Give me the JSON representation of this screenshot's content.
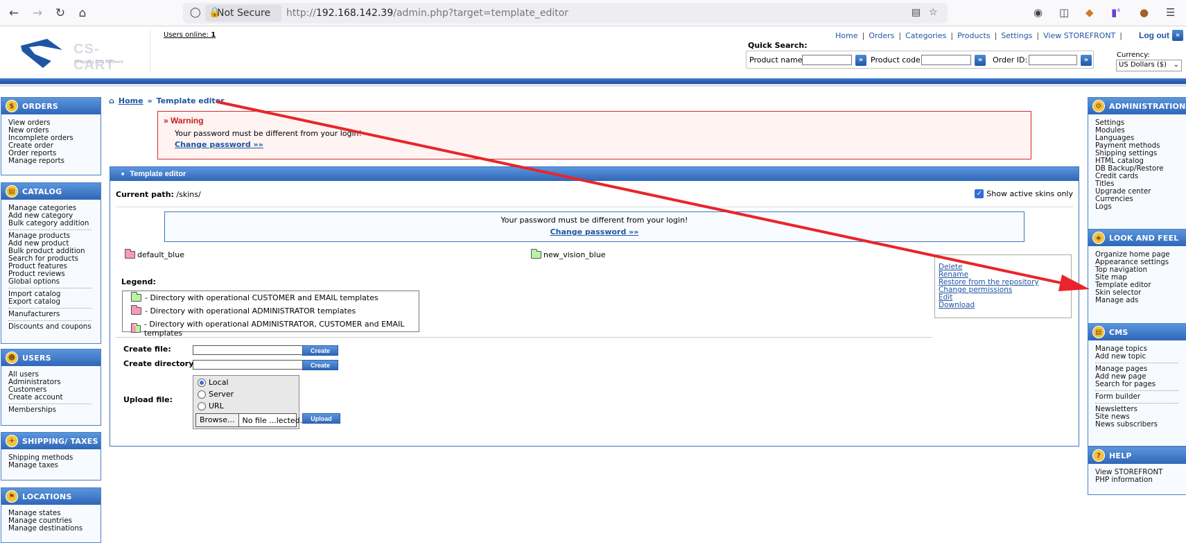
{
  "browser": {
    "security_label": "Not Secure",
    "url_prefix": "http://",
    "url_host": "192.168.142.39",
    "url_path": "/admin.php?target=template_editor",
    "extension_badge": "4"
  },
  "header": {
    "logo_text": "CS-CART",
    "logo_subtitle": "Shopping Cart Software",
    "users_online_label": "Users online:",
    "users_online_count": "1",
    "nav": [
      "Home",
      "Orders",
      "Categories",
      "Products",
      "Settings",
      "View STOREFRONT"
    ],
    "logout": "Log out",
    "quick_search": {
      "title": "Quick Search:",
      "product_name_label": "Product name:",
      "product_code_label": "Product code:",
      "order_id_label": "Order ID:"
    },
    "currency_label": "Currency:",
    "currency_value": "US Dollars ($)"
  },
  "left_menu": {
    "orders": {
      "title": "ORDERS",
      "items": [
        "View orders",
        "New orders",
        "Incomplete orders",
        "Create order",
        "Order reports",
        "Manage reports"
      ]
    },
    "catalog": {
      "title": "CATALOG",
      "groups": [
        [
          "Manage categories",
          "Add new category",
          "Bulk category addition"
        ],
        [
          "Manage products",
          "Add new product",
          "Bulk product addition",
          "Search for products",
          "Product features",
          "Product reviews",
          "Global options"
        ],
        [
          "Import catalog",
          "Export catalog"
        ],
        [
          "Manufacturers"
        ],
        [
          "Discounts and coupons"
        ]
      ]
    },
    "users": {
      "title": "USERS",
      "groups": [
        [
          "All users",
          "Administrators",
          "Customers",
          "Create account"
        ],
        [
          "Memberships"
        ]
      ]
    },
    "shipping": {
      "title": "SHIPPING/ TAXES",
      "items": [
        "Shipping methods",
        "Manage taxes"
      ]
    },
    "locations": {
      "title": "LOCATIONS",
      "items": [
        "Manage states",
        "Manage countries",
        "Manage destinations"
      ]
    }
  },
  "right_menu": {
    "administration": {
      "title": "ADMINISTRATION",
      "items": [
        "Settings",
        "Modules",
        "Languages",
        "Payment methods",
        "Shipping settings",
        "HTML catalog",
        "DB Backup/Restore",
        "Credit cards",
        "Titles",
        "Upgrade center",
        "Currencies",
        "Logs"
      ]
    },
    "look_feel": {
      "title": "LOOK AND FEEL",
      "items": [
        "Organize home page",
        "Appearance settings",
        "Top navigation",
        "Site map",
        "Template editor",
        "Skin selector",
        "Manage ads"
      ]
    },
    "cms": {
      "title": "CMS",
      "groups": [
        [
          "Manage topics",
          "Add new topic"
        ],
        [
          "Manage pages",
          "Add new page",
          "Search for pages"
        ],
        [
          "Form builder"
        ],
        [
          "Newsletters",
          "Site news",
          "News subscribers"
        ]
      ]
    },
    "help": {
      "title": "HELP",
      "items": [
        "View STOREFRONT",
        "PHP information"
      ]
    }
  },
  "breadcrumb": {
    "home": "Home",
    "current": "Template editor"
  },
  "warning": {
    "title": "Warning",
    "text": "Your password must be different from your login!",
    "link": "Change password »»"
  },
  "template_editor": {
    "title": "Template editor",
    "current_path_label": "Current path:",
    "current_path": "/skins/",
    "show_active_label": "Show active skins only",
    "notice_text": "Your password must be different from your login!",
    "notice_link": "Change password »»",
    "folders": [
      "default_blue",
      "new_vision_blue"
    ],
    "legend_title": "Legend:",
    "legend": [
      "- Directory with operational CUSTOMER and EMAIL templates",
      "- Directory with operational ADMINISTRATOR templates",
      "- Directory with operational ADMINISTRATOR, CUSTOMER and EMAIL templates"
    ],
    "actions": [
      "Delete",
      "Rename",
      "Restore from the repository",
      "Change permissions",
      "Edit",
      "Download"
    ],
    "create_file_label": "Create file:",
    "create_dir_label": "Create directory:",
    "create_btn": "Create",
    "upload_label": "Upload file:",
    "upload_options": [
      "Local",
      "Server",
      "URL"
    ],
    "browse_btn": "Browse...",
    "no_file": "No file ...lected.",
    "upload_btn": "Upload"
  },
  "colors": {
    "accent": "#2f66b8",
    "link": "#1f55a3",
    "warning": "#d4282d",
    "arrow": "#e8252b"
  }
}
